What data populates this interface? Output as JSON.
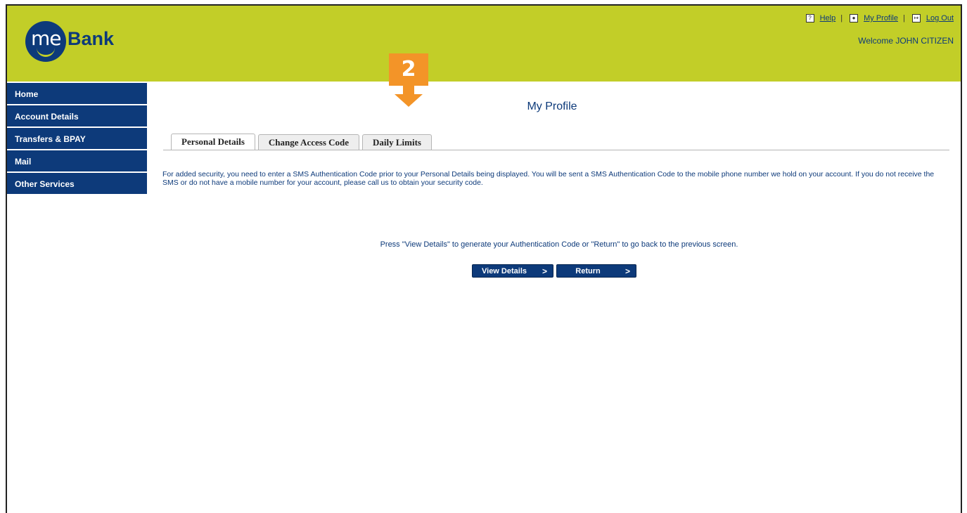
{
  "header": {
    "brand_logo": "meBank",
    "links": {
      "help": "Help",
      "my_profile": "My Profile",
      "log_out": "Log Out"
    },
    "welcome": "Welcome JOHN CITIZEN"
  },
  "sidebar": {
    "items": [
      {
        "label": "Home"
      },
      {
        "label": "Account Details"
      },
      {
        "label": "Transfers & BPAY"
      },
      {
        "label": "Mail"
      },
      {
        "label": "Other Services"
      }
    ]
  },
  "marker": {
    "number": "2"
  },
  "main": {
    "title": "My Profile",
    "tabs": [
      {
        "label": "Personal Details"
      },
      {
        "label": "Change Access Code"
      },
      {
        "label": "Daily Limits"
      }
    ],
    "info": "For added security, you need to enter a SMS Authentication Code prior to your Personal Details being displayed. You will be sent a SMS Authentication Code to the mobile phone number we hold on your account. If you do not receive the SMS or do not have a mobile number for your account, please call us to obtain your security code.",
    "instruction": "Press \"View Details\" to generate your Authentication Code or \"Return\" to go back to the previous screen.",
    "buttons": {
      "view_details": "View Details",
      "return": "Return",
      "arrow": ">"
    }
  },
  "colors": {
    "header_bg": "#c2ce28",
    "nav_bg": "#0d3a7a",
    "marker": "#f39428"
  }
}
